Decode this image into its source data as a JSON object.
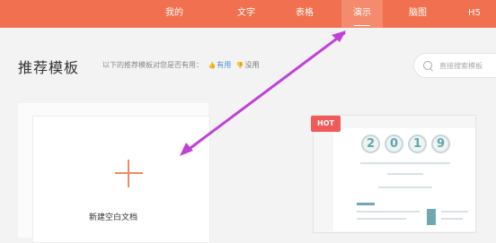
{
  "nav": {
    "tabs": [
      {
        "label": "我的"
      },
      {
        "label": "文字"
      },
      {
        "label": "表格"
      },
      {
        "label": "演示",
        "active": true
      },
      {
        "label": "脑图"
      },
      {
        "label": "H5"
      }
    ]
  },
  "section": {
    "title": "推荐模板",
    "feedback_prompt": "以下的推荐模板对您是否有用：",
    "useful_label": "有用",
    "useless_label": "没用"
  },
  "search": {
    "placeholder": "直接搜索模板"
  },
  "blank_card": {
    "label": "新建空白文档"
  },
  "template_card": {
    "badge": "HOT",
    "year_digits": [
      "2",
      "0",
      "1",
      "9"
    ]
  },
  "colors": {
    "topbar": "#f0704f",
    "accent": "#f08a62",
    "hot_badge": "#f05a58",
    "annotation_arrow": "#c041d8"
  }
}
